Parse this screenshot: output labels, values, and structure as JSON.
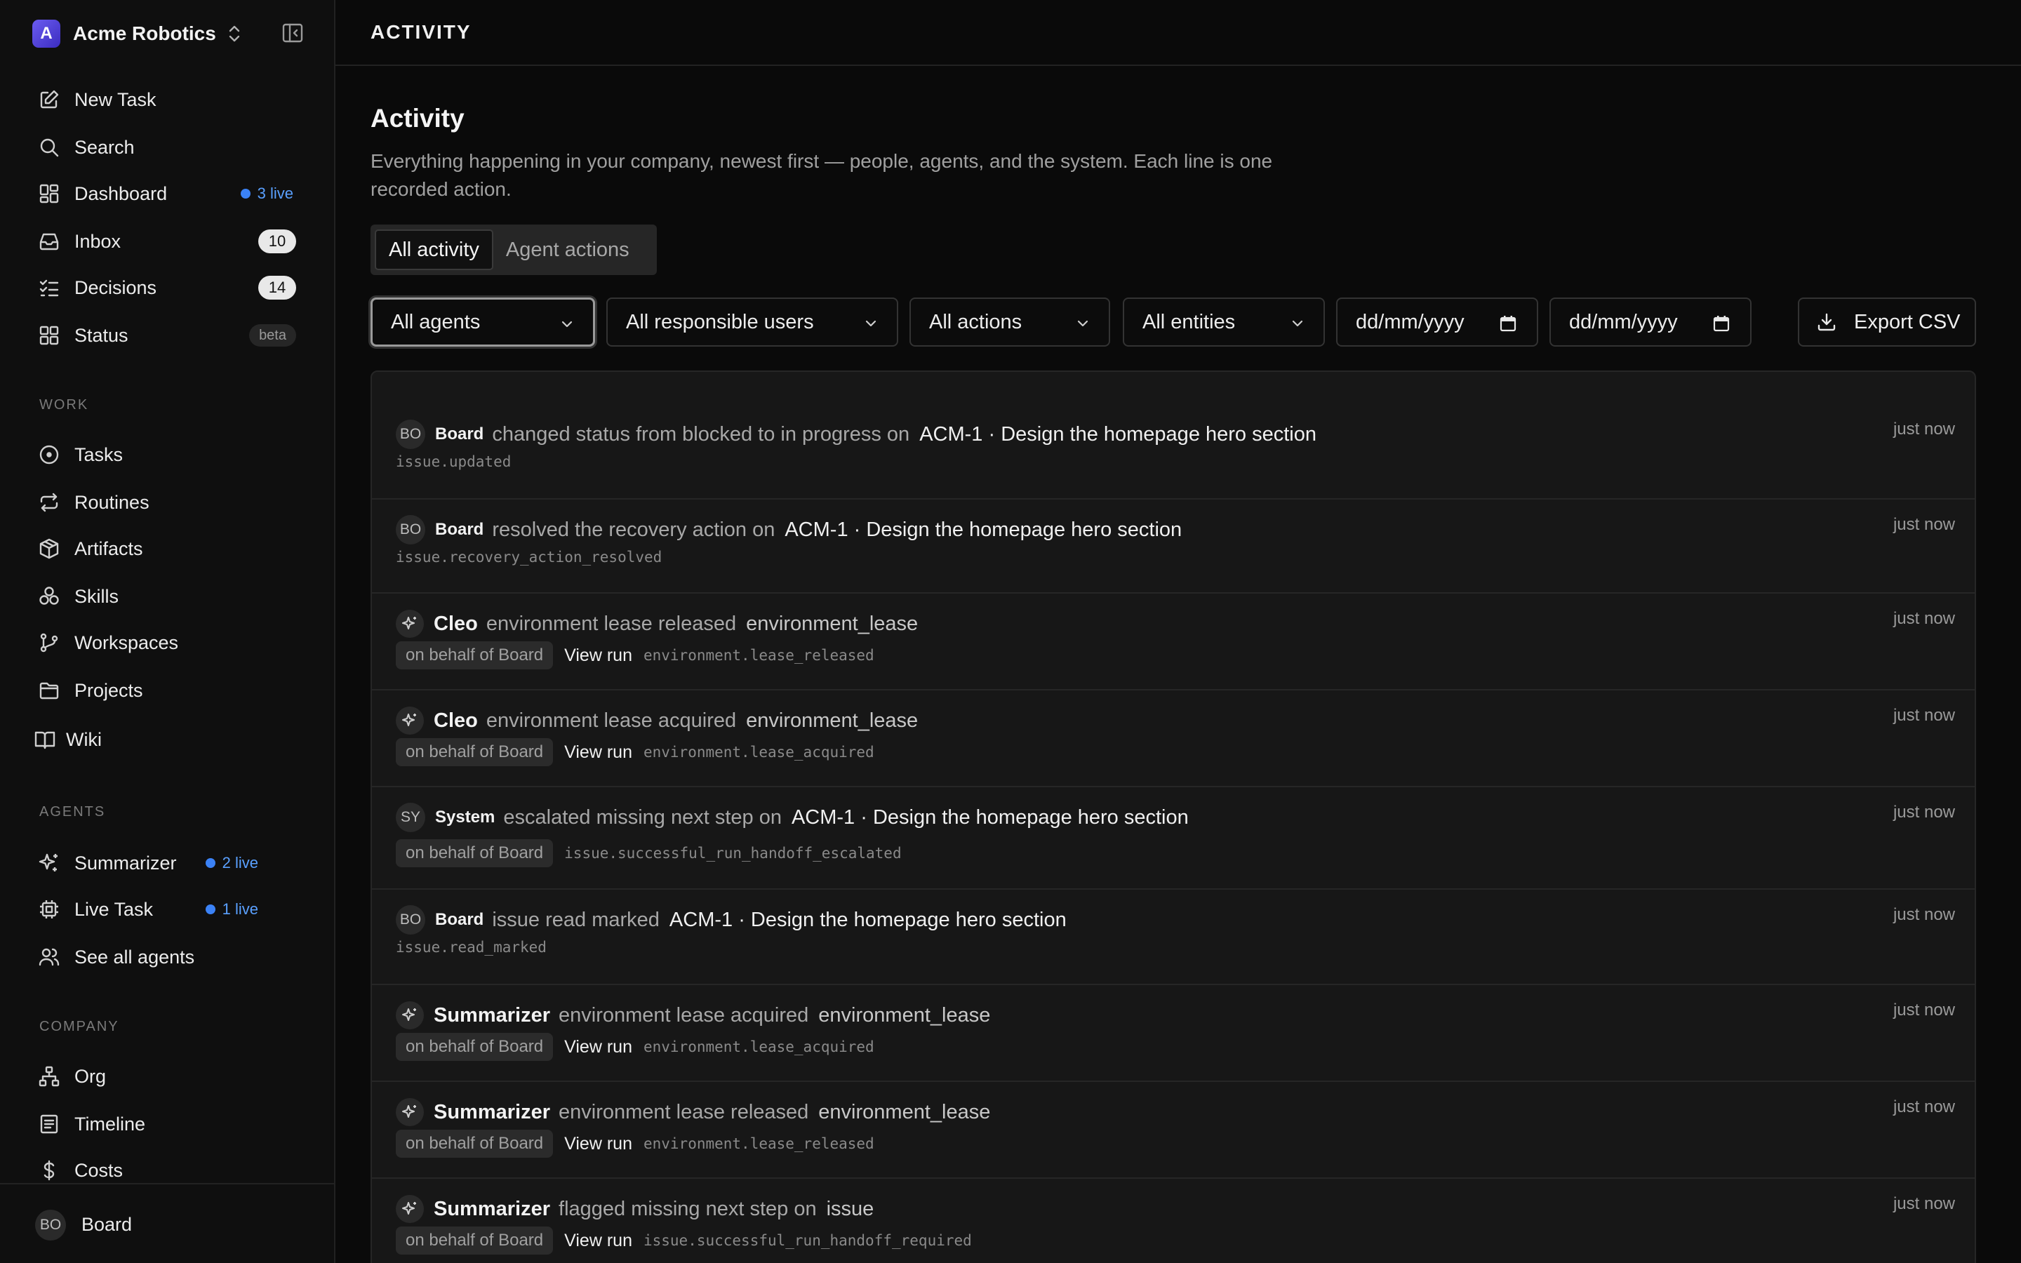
{
  "sidebar": {
    "company": {
      "logo_letter": "A",
      "name": "Acme Robotics"
    },
    "nav": [
      {
        "id": "new-task",
        "label": "New Task",
        "icon": "pencil-square-icon"
      },
      {
        "id": "search",
        "label": "Search",
        "icon": "search-icon"
      },
      {
        "id": "dashboard",
        "label": "Dashboard",
        "icon": "dashboard-grid-icon",
        "live": "3 live"
      },
      {
        "id": "inbox",
        "label": "Inbox",
        "icon": "inbox-icon",
        "count": "10"
      },
      {
        "id": "decisions",
        "label": "Decisions",
        "icon": "checklist-icon",
        "count": "14"
      },
      {
        "id": "status",
        "label": "Status",
        "icon": "status-grid-icon",
        "tag": "beta"
      }
    ],
    "work_label": "WORK",
    "work": [
      {
        "id": "tasks",
        "label": "Tasks",
        "icon": "circle-dot-icon"
      },
      {
        "id": "routines",
        "label": "Routines",
        "icon": "repeat-icon"
      },
      {
        "id": "artifacts",
        "label": "Artifacts",
        "icon": "package-icon"
      },
      {
        "id": "skills",
        "label": "Skills",
        "icon": "skills-icon"
      },
      {
        "id": "workspaces",
        "label": "Workspaces",
        "icon": "git-branch-icon"
      },
      {
        "id": "projects",
        "label": "Projects",
        "icon": "folder-icon"
      },
      {
        "id": "wiki",
        "label": "Wiki",
        "icon": "book-icon"
      }
    ],
    "agents_label": "AGENTS",
    "agents": [
      {
        "id": "summarizer",
        "label": "Summarizer",
        "icon": "sparkle-icon",
        "live": "2 live"
      },
      {
        "id": "live-task",
        "label": "Live Task",
        "icon": "cpu-icon",
        "live": "1 live"
      },
      {
        "id": "see-all-agents",
        "label": "See all agents",
        "icon": "users-icon"
      }
    ],
    "company_label": "COMPANY",
    "company_nav": [
      {
        "id": "org",
        "label": "Org",
        "icon": "org-chart-icon"
      },
      {
        "id": "timeline",
        "label": "Timeline",
        "icon": "timeline-icon"
      },
      {
        "id": "costs",
        "label": "Costs",
        "icon": "dollar-icon"
      }
    ],
    "user": {
      "initials": "BO",
      "name": "Board"
    }
  },
  "header": {
    "title": "ACTIVITY"
  },
  "page": {
    "title": "Activity",
    "description": "Everything happening in your company, newest first — people, agents, and the system. Each line is one recorded action."
  },
  "tabs": [
    {
      "label": "All activity",
      "active": true
    },
    {
      "label": "Agent actions",
      "active": false
    }
  ],
  "filters": {
    "agents": "All agents",
    "users": "All responsible users",
    "actions": "All actions",
    "entities": "All entities",
    "date_from": "dd/mm/yyyy",
    "date_to": "dd/mm/yyyy",
    "export": "Export CSV"
  },
  "activity": [
    {
      "avatar": "BO",
      "actor": "Board",
      "verb": "changed status from blocked to in progress on",
      "entity": "ACM-1 · Design the homepage hero section",
      "code": "issue.updated",
      "time": "just now"
    },
    {
      "avatar": "BO",
      "actor": "Board",
      "verb": "resolved the recovery action on",
      "entity": "ACM-1 · Design the homepage hero section",
      "code": "issue.recovery_action_resolved",
      "time": "just now"
    },
    {
      "actor": "Cleo",
      "verb": "environment lease released",
      "entity": "environment_lease",
      "pill": "on behalf of Board",
      "link": "View run",
      "code": "environment.lease_released",
      "time": "just now"
    },
    {
      "actor": "Cleo",
      "verb": "environment lease acquired",
      "entity": "environment_lease",
      "pill": "on behalf of Board",
      "link": "View run",
      "code": "environment.lease_acquired",
      "time": "just now"
    },
    {
      "avatar": "SY",
      "actor": "System",
      "verb": "escalated missing next step on",
      "entity": "ACM-1 · Design the homepage hero section",
      "pill": "on behalf of Board",
      "code": "issue.successful_run_handoff_escalated",
      "time": "just now"
    },
    {
      "avatar": "BO",
      "actor": "Board",
      "verb": "issue read marked",
      "entity": "ACM-1 · Design the homepage hero section",
      "code": "issue.read_marked",
      "time": "just now"
    },
    {
      "actor": "Summarizer",
      "verb": "environment lease acquired",
      "entity": "environment_lease",
      "pill": "on behalf of Board",
      "link": "View run",
      "code": "environment.lease_acquired",
      "time": "just now"
    },
    {
      "actor": "Summarizer",
      "verb": "environment lease released",
      "entity": "environment_lease",
      "pill": "on behalf of Board",
      "link": "View run",
      "code": "environment.lease_released",
      "time": "just now"
    },
    {
      "actor": "Summarizer",
      "verb": "flagged missing next step on",
      "entity": "issue",
      "pill": "on behalf of Board",
      "link": "View run",
      "code": "issue.successful_run_handoff_required",
      "time": "just now"
    }
  ],
  "colors": {
    "accent_live": "#3b82f6",
    "background": "#0a0a0a",
    "panel": "#171717"
  }
}
